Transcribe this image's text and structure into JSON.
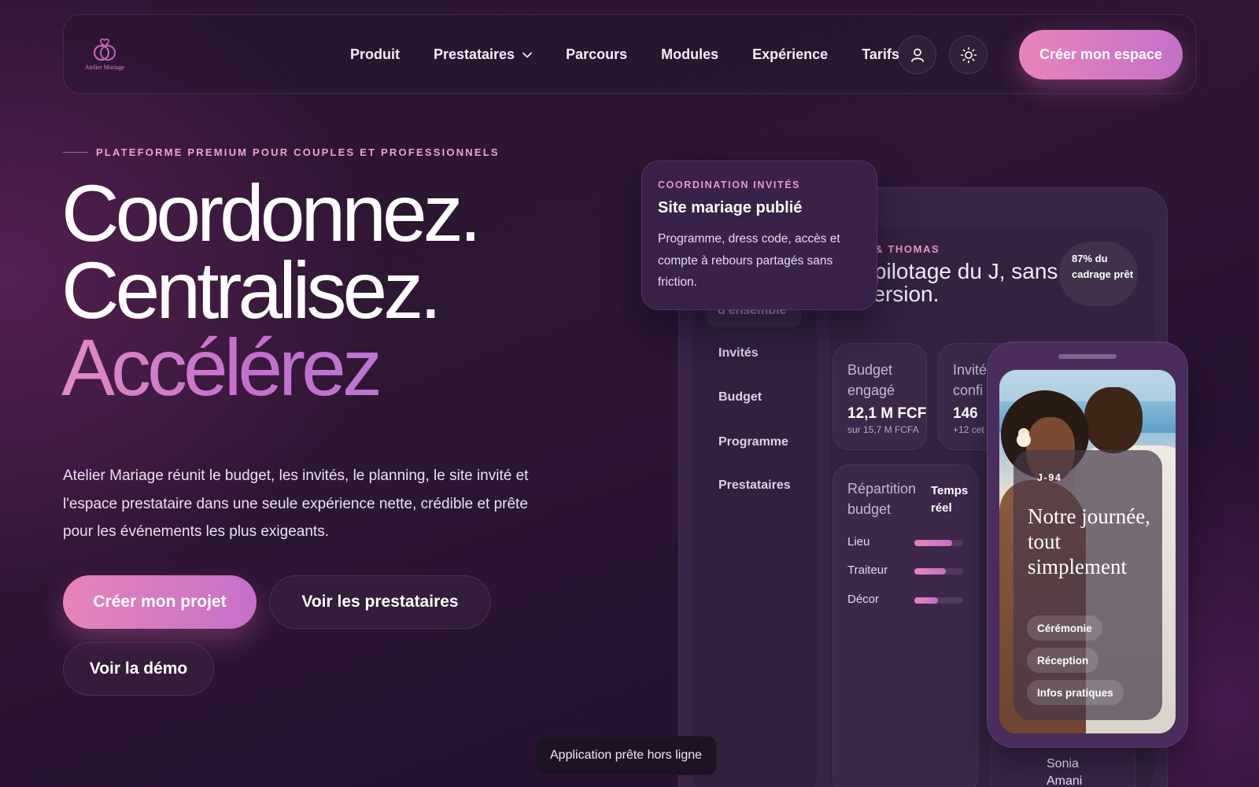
{
  "brand": {
    "name": "Atelier Mariage",
    "accent": "#e785b8",
    "accent_2": "#c56fc9"
  },
  "nav": {
    "links": [
      "Produit",
      "Prestataires",
      "Parcours",
      "Modules",
      "Expérience",
      "Tarifs"
    ],
    "prestataires_has_dropdown": true,
    "account_icon": "user-icon",
    "theme_icon": "sun-icon",
    "cta": "Créer mon espace"
  },
  "hero": {
    "eyebrow": "PLATEFORME PREMIUM POUR COUPLES ET PROFESSIONNELS",
    "headline": [
      "Coordonnez.",
      "Centralisez.",
      "Accélérez"
    ],
    "lead": "Atelier Mariage réunit le budget, les invités, le planning, le site invité et l'espace prestataire dans une seule expérience nette, crédible et prête pour les événements les plus exigeants.",
    "primary_cta": "Créer mon projet",
    "secondary_cta": "Voir les prestataires",
    "demo_cta": "Voir la démo"
  },
  "toast": "Application prête hors ligne",
  "float_card": {
    "eyebrow": "COORDINATION INVITÉS",
    "title": "Site mariage publié",
    "body": "Programme, dress code, accès et compte à rebours partagés sans friction."
  },
  "dashboard": {
    "sidebar": {
      "active_label": "d'ensemble",
      "items": [
        "Invités",
        "Budget",
        "Programme",
        "Prestataires"
      ]
    },
    "project_eyebrow": "E AWA & THOMAS",
    "project_title": ":t le pilotage du J, sans dispersion.",
    "progress_badge": "87% du cadrage prêt",
    "stats": [
      {
        "label": "Budget engagé",
        "value": "12,1 M FCFA",
        "sub": "sur 15,7 M FCFA"
      },
      {
        "label": "Invité confi",
        "value": "146",
        "sub": "+12 cet"
      }
    ],
    "budget_breakdown": {
      "title": "Répartition budget",
      "live_label": "Temps réel",
      "rows": [
        {
          "label": "Lieu",
          "fraction": 0.78
        },
        {
          "label": "Traiteur",
          "fraction": 0.64
        },
        {
          "label": "Décor",
          "fraction": 0.48
        }
      ]
    },
    "contact_stub": "Sonia Amani"
  },
  "phone": {
    "countdown": "J-94",
    "title": "Notre journée, tout simplement",
    "chips": [
      "Cérémonie",
      "Réception",
      "Infos pratiques"
    ]
  }
}
